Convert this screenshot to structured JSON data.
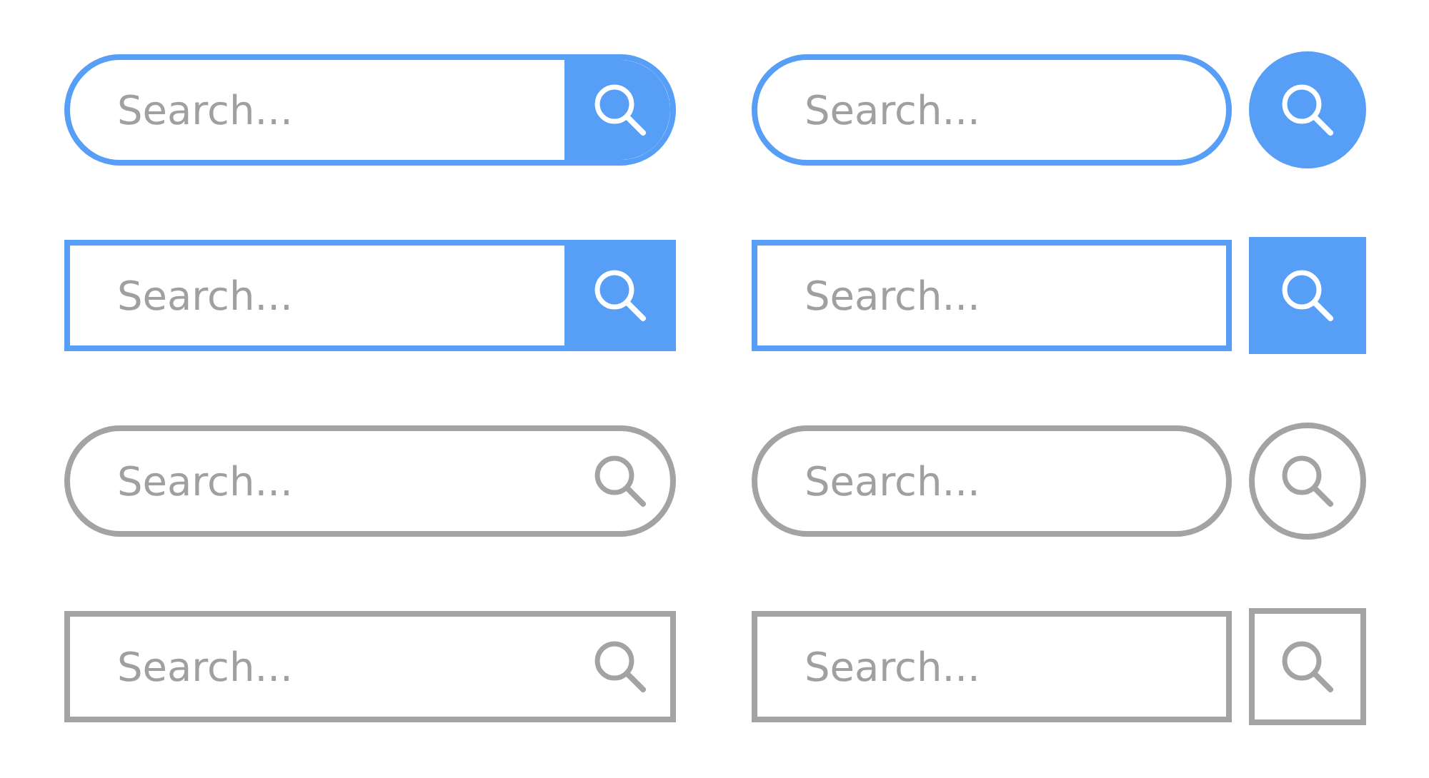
{
  "search_bars": [
    {
      "placeholder": "Search...",
      "kind": "pill",
      "separate_button": false,
      "filled": true,
      "color": "#579ef7"
    },
    {
      "placeholder": "Search...",
      "kind": "pill",
      "separate_button": true,
      "filled": true,
      "color": "#579ef7"
    },
    {
      "placeholder": "Search...",
      "kind": "box",
      "separate_button": false,
      "filled": true,
      "color": "#579ef7"
    },
    {
      "placeholder": "Search...",
      "kind": "box",
      "separate_button": true,
      "filled": true,
      "color": "#579ef7"
    },
    {
      "placeholder": "Search...",
      "kind": "pill",
      "separate_button": false,
      "filled": false,
      "color": "#a3a3a3"
    },
    {
      "placeholder": "Search...",
      "kind": "pill",
      "separate_button": true,
      "filled": false,
      "color": "#a3a3a3"
    },
    {
      "placeholder": "Search...",
      "kind": "box",
      "separate_button": false,
      "filled": false,
      "color": "#a3a3a3"
    },
    {
      "placeholder": "Search...",
      "kind": "box",
      "separate_button": true,
      "filled": false,
      "color": "#a3a3a3"
    }
  ]
}
